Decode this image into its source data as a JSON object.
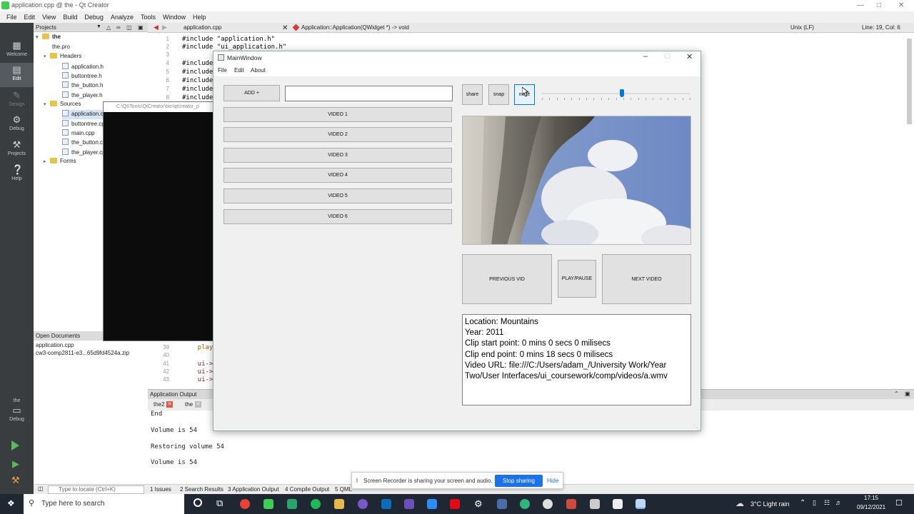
{
  "qtcreator": {
    "window_title": "application.cpp @ the - Qt Creator",
    "menu": [
      "File",
      "Edit",
      "View",
      "Build",
      "Debug",
      "Analyze",
      "Tools",
      "Window",
      "Help"
    ],
    "modes": [
      "Welcome",
      "Edit",
      "Design",
      "Debug",
      "Projects",
      "Help"
    ],
    "run_target_label": "the",
    "run_target_mode": "Debug",
    "projects_panel_title": "Projects",
    "tree": {
      "root": "the",
      "pro_file": "the.pro",
      "headers_label": "Headers",
      "headers": [
        "application.h",
        "buttontree.h",
        "the_button.h",
        "the_player.h"
      ],
      "sources_label": "Sources",
      "sources": [
        "application.cpp",
        "buttontree.cpp",
        "main.cpp",
        "the_button.cpp",
        "the_player.cpp"
      ],
      "forms_label": "Forms"
    },
    "open_documents_title": "Open Documents",
    "open_documents": [
      "application.cpp",
      "cw3-comp2811-e3...65d9fd4524a.zip"
    ],
    "editor_tab": "application.cpp",
    "function_crumb": "Application::Application(QWidget *) -> void",
    "line_ending": "Unix (LF)",
    "cursor_pos": "Line: 19, Col: 6",
    "code_top": [
      {
        "n": "1",
        "t": "#include \"application.h\""
      },
      {
        "n": "2",
        "t": "#include \"ui_application.h\""
      },
      {
        "n": "3",
        "t": ""
      },
      {
        "n": "4",
        "t": "#include"
      },
      {
        "n": "5",
        "t": "#include"
      },
      {
        "n": "6",
        "t": "#include"
      },
      {
        "n": "7",
        "t": "#include"
      },
      {
        "n": "8",
        "t": "#include"
      }
    ],
    "code_bottom": [
      {
        "n": "39",
        "t": "    play"
      },
      {
        "n": "40",
        "t": ""
      },
      {
        "n": "41",
        "t": "    ui->"
      },
      {
        "n": "42",
        "t": "    ui->"
      },
      {
        "n": "43",
        "t": "    ui->"
      }
    ],
    "terminal_title": "C:\\Qt\\Tools\\QtCreator\\bin\\qtcreator_p",
    "app_output_title": "Application Output",
    "output_tabs": [
      "the2",
      "the"
    ],
    "output_lines": [
      "End",
      "",
      "Volume is  54",
      "",
      "Restoring volume 54",
      "",
      "Volume is  54"
    ],
    "locator_placeholder": "Type to locate (Ctrl+K)",
    "status_items": [
      "1  Issues",
      "2  Search Results",
      "3  Application Output",
      "4  Compile Output",
      "5  QML"
    ]
  },
  "share_bar": {
    "text": "Screen Recorder is sharing your screen and audio.",
    "stop": "Stop sharing",
    "hide": "Hide"
  },
  "taskbar": {
    "search_placeholder": "Type here to search",
    "weather": "3°C  Light rain",
    "time": "17:15",
    "date": "09/12/2021"
  },
  "mainwindow": {
    "title": "MainWindow",
    "menu": [
      "File",
      "Edit",
      "About"
    ],
    "add_button": "ADD +",
    "path_value": "",
    "video_buttons": [
      "VIDEO 1",
      "VIDEO 2",
      "VIDEO 3",
      "VIDEO 4",
      "VIDEO 5",
      "VIDEO 6"
    ],
    "share_button": "share",
    "snap_button": "snap",
    "mute_button": "mute",
    "volume_fraction": 0.54,
    "prev_button": "PREVIOUS VID",
    "play_button": "PLAY/PAUSE",
    "next_button": "NEXT VIDEO",
    "info_lines": [
      "Location: Mountains",
      "Year: 2011",
      "Clip start point: 0 mins 0 secs 0 milisecs",
      "Clip end point: 0 mins 18 secs 0 milisecs",
      "Video URL: file:///C:/Users/adam_/University Work/Year",
      "Two/User Interfaces/ui_coursework/comp/videos/a.wmv"
    ]
  }
}
